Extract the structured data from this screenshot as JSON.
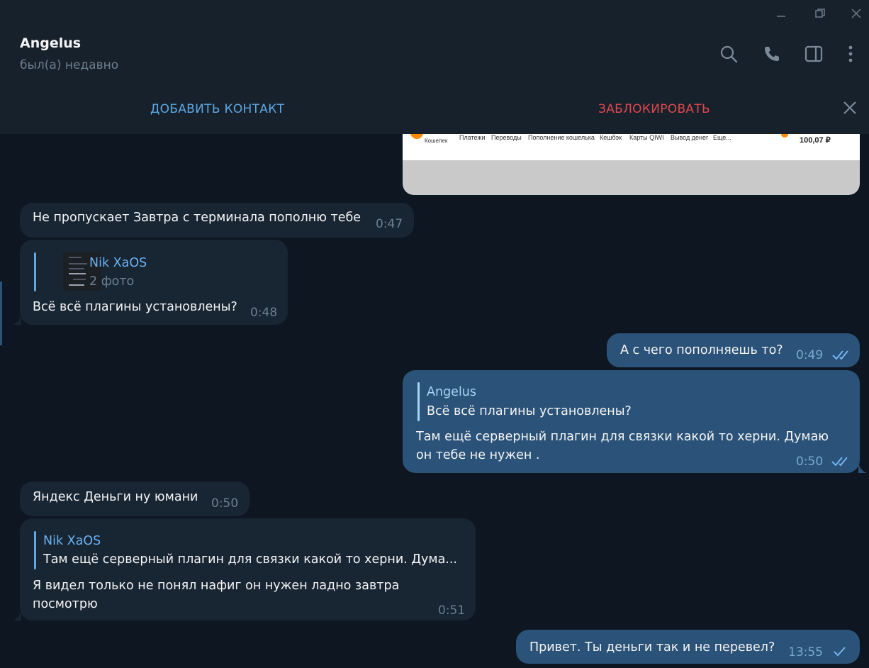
{
  "window": {
    "minimize_icon": "minimize-icon",
    "restore_icon": "restore-icon",
    "close_icon": "close-icon"
  },
  "header": {
    "title": "Angelus",
    "status": "был(а) недавно",
    "icons": [
      "search-icon",
      "phone-icon",
      "sidebar-icon",
      "more-vertical-icon"
    ]
  },
  "actions": {
    "add_contact": "ДОБАВИТЬ КОНТАКТ",
    "block": "ЗАБЛОКИРОВАТЬ",
    "close_icon": "close-icon"
  },
  "image_preview": {
    "brand": "Кошелек",
    "nav": [
      "Платежи",
      "Переводы",
      "Пополнение кошелька",
      "Кешбэк",
      "Карты QIWI",
      "Вывод денег",
      "Еще..."
    ],
    "balance": "100,07 ₽"
  },
  "messages": [
    {
      "direction": "in",
      "text": "Не пропускает Завтра с терминала пополню тебе",
      "time": "0:47"
    },
    {
      "direction": "in",
      "reply": {
        "name": "Nik XaOS",
        "text": "2 фото"
      },
      "text": "Всё всё плагины установлены?",
      "time": "0:48"
    },
    {
      "direction": "out",
      "text": "А с чего пополняешь то?",
      "time": "0:49",
      "status": "read"
    },
    {
      "direction": "out",
      "reply": {
        "name": "Angelus",
        "text": "Всё всё плагины установлены?"
      },
      "lines": [
        "Там ещё серверный плагин для связки какой то херни. Думаю",
        "он тебе не нужен ."
      ],
      "time": "0:50",
      "status": "read"
    },
    {
      "direction": "in",
      "text": "Яндекс Деньги ну юмани",
      "time": "0:50"
    },
    {
      "direction": "in",
      "reply": {
        "name": "Nik XaOS",
        "text": "Там ещё серверный плагин для связки какой то херни. Дума..."
      },
      "lines": [
        "Я видел только не понял нафиг он нужен ладно завтра",
        "посмотрю"
      ],
      "time": "0:51"
    },
    {
      "direction": "out",
      "text": "Привет. Ты деньги так и не перевел?",
      "time": "13:55",
      "status": "sent"
    }
  ],
  "colors": {
    "background": "#0e1621",
    "panel": "#17212b",
    "incoming": "#182533",
    "outgoing": "#2b5278",
    "accent": "#5ea9e6",
    "danger": "#e0474f"
  }
}
